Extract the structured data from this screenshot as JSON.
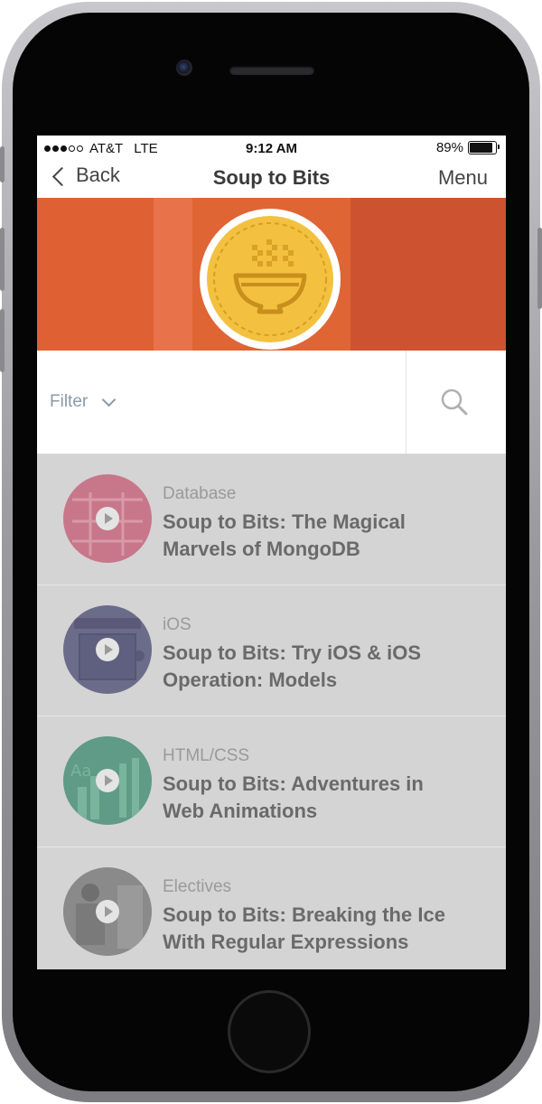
{
  "status_bar": {
    "carrier": "AT&T",
    "network": "LTE",
    "time": "9:12 AM",
    "battery": "89%",
    "battery_level": 0.89,
    "signal_bars": 3
  },
  "nav": {
    "back_label": "Back",
    "title": "Soup to Bits",
    "menu_label": "Menu"
  },
  "filter": {
    "label": "Filter"
  },
  "courses": [
    {
      "category": "Database",
      "title": "Soup to Bits: The Magical Marvels of MongoDB",
      "thumb_color": "#c8778a"
    },
    {
      "category": "iOS",
      "title": "Soup to Bits: Try iOS & iOS Operation: Models",
      "thumb_color": "#6b6b8a"
    },
    {
      "category": "HTML/CSS",
      "title": "Soup to Bits: Adventures in Web Animations",
      "thumb_color": "#5f9b86"
    },
    {
      "category": "Electives",
      "title": "Soup to Bits: Breaking the Ice With Regular Expressions",
      "thumb_color": "#8a8a8a"
    }
  ],
  "colors": {
    "banner": "#de6033",
    "badge": "#f3c13f",
    "list_background": "#d4d4d4"
  }
}
